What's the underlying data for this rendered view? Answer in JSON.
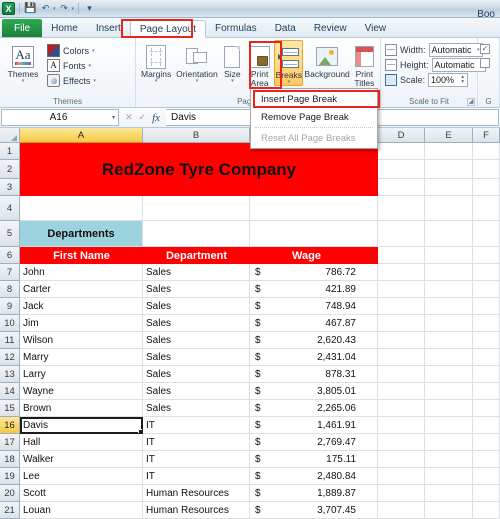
{
  "window": {
    "title": "Boo",
    "app_icon": "excel-logo-icon"
  },
  "quick_access": {
    "save_label": "■",
    "undo_label": "↶",
    "redo_label": "↷",
    "customize_label": "▾"
  },
  "ribbon": {
    "tabs": [
      {
        "label": "File",
        "id": "file"
      },
      {
        "label": "Home",
        "id": "home"
      },
      {
        "label": "Insert",
        "id": "insert"
      },
      {
        "label": "Page Layout",
        "id": "page-layout",
        "active": true,
        "annotated": true
      },
      {
        "label": "Formulas",
        "id": "formulas"
      },
      {
        "label": "Data",
        "id": "data"
      },
      {
        "label": "Review",
        "id": "review"
      },
      {
        "label": "View",
        "id": "view"
      }
    ],
    "groups": {
      "themes": {
        "label": "Themes",
        "themes_button": "Themes",
        "colors": "Colors",
        "fonts": "Fonts",
        "effects": "Effects",
        "font_glyph": "A"
      },
      "page_setup": {
        "label": "Page Setup",
        "margins": "Margins",
        "orientation": "Orientation",
        "size": "Size",
        "print_area": "Print\nArea",
        "print_area_l1": "Print",
        "print_area_l2": "Area",
        "breaks": "Breaks",
        "background": "Background",
        "print_titles_l1": "Print",
        "print_titles_l2": "Titles"
      },
      "scale_to_fit": {
        "label": "Scale to Fit",
        "width_label": "Width:",
        "width_value": "Automatic",
        "height_label": "Height:",
        "height_value": "Automatic",
        "scale_label": "Scale:",
        "scale_value": "100%"
      },
      "sheet_options": {
        "label": "G"
      }
    }
  },
  "breaks_menu": {
    "items": [
      {
        "label": "Insert Page Break",
        "disabled": false,
        "annotated": true
      },
      {
        "label": "Remove Page Break",
        "disabled": false,
        "annotated": false
      },
      {
        "label": "Reset All Page Breaks",
        "disabled": true,
        "annotated": false
      }
    ]
  },
  "formula_bar": {
    "name_box_value": "A16",
    "cancel_icon": "✕",
    "enter_icon": "✓",
    "fx_icon": "fx",
    "formula_value": "Davis"
  },
  "sheet": {
    "columns": [
      "A",
      "B",
      "C",
      "D",
      "E",
      "F"
    ],
    "selected_column": "A",
    "selected_row": 16,
    "banner": {
      "row_span": [
        1,
        2,
        3
      ],
      "text": "RedZone Tyre Company",
      "color": "#ff0000"
    },
    "departments_cell": {
      "row": 5,
      "text": "Departments",
      "color": "#9dd3de"
    },
    "header_row": {
      "row": 6,
      "first_name": "First Name",
      "department": "Department",
      "wage": "Wage"
    },
    "currency_symbol": "$",
    "rows": [
      {
        "n": 7,
        "name": "John",
        "dept": "Sales",
        "wage": "786.72"
      },
      {
        "n": 8,
        "name": "Carter",
        "dept": "Sales",
        "wage": "421.89"
      },
      {
        "n": 9,
        "name": "Jack",
        "dept": "Sales",
        "wage": "748.94"
      },
      {
        "n": 10,
        "name": "Jim",
        "dept": "Sales",
        "wage": "467.87"
      },
      {
        "n": 11,
        "name": "Wilson",
        "dept": "Sales",
        "wage": "2,620.43"
      },
      {
        "n": 12,
        "name": "Marry",
        "dept": "Sales",
        "wage": "2,431.04"
      },
      {
        "n": 13,
        "name": "Larry",
        "dept": "Sales",
        "wage": "878.31"
      },
      {
        "n": 14,
        "name": "Wayne",
        "dept": "Sales",
        "wage": "3,805.01"
      },
      {
        "n": 15,
        "name": "Brown",
        "dept": "Sales",
        "wage": "2,265.06"
      },
      {
        "n": 16,
        "name": "Davis",
        "dept": "IT",
        "wage": "1,461.91"
      },
      {
        "n": 17,
        "name": "Hall",
        "dept": "IT",
        "wage": "2,769.47"
      },
      {
        "n": 18,
        "name": "Walker",
        "dept": "IT",
        "wage": "175.11"
      },
      {
        "n": 19,
        "name": "Lee",
        "dept": "IT",
        "wage": "2,480.84"
      },
      {
        "n": 20,
        "name": "Scott",
        "dept": "Human Resources",
        "wage": "1,889.87"
      },
      {
        "n": 21,
        "name": "Louan",
        "dept": "Human Resources",
        "wage": "3,707.45"
      }
    ]
  },
  "colors": {
    "banner_red": "#ff0000",
    "dept_blue": "#9dd3de",
    "annotation_red": "#e8241c",
    "selection_gold": "#f5c842",
    "file_tab_green": "#1c8038"
  }
}
